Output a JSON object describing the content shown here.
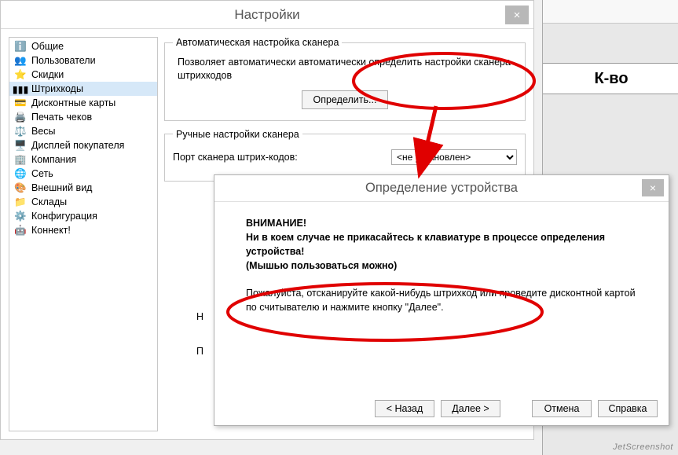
{
  "mainWindow": {
    "title": "Настройки",
    "close": "×"
  },
  "sidebar": {
    "items": [
      {
        "icon": "ℹ️",
        "label": "Общие"
      },
      {
        "icon": "👥",
        "label": "Пользователи"
      },
      {
        "icon": "⭐",
        "label": "Скидки"
      },
      {
        "icon": "▮▮▮",
        "label": "Штрихкоды",
        "selected": true
      },
      {
        "icon": "💳",
        "label": "Дисконтные карты"
      },
      {
        "icon": "🖨️",
        "label": "Печать чеков"
      },
      {
        "icon": "⚖️",
        "label": "Весы"
      },
      {
        "icon": "🖥️",
        "label": "Дисплей покупателя"
      },
      {
        "icon": "🏢",
        "label": "Компания"
      },
      {
        "icon": "🌐",
        "label": "Сеть"
      },
      {
        "icon": "🎨",
        "label": "Внешний вид"
      },
      {
        "icon": "📁",
        "label": "Склады"
      },
      {
        "icon": "⚙️",
        "label": "Конфигурация"
      },
      {
        "icon": "🤖",
        "label": "Коннект!"
      }
    ]
  },
  "autoGroup": {
    "legend": "Автоматическая настройка сканера",
    "desc": "Позволяет автоматически автоматически определить настройки сканера штрихкодов",
    "btn": "Определить..."
  },
  "manualGroup": {
    "legend": "Ручные настройки сканера",
    "portLabel": "Порт сканера штрих-кодов:",
    "portValue": "<не установлен>"
  },
  "hidden": {
    "h1": "Н",
    "h2": "П"
  },
  "modal": {
    "title": "Определение устройства",
    "close": "×",
    "warnTitle": "ВНИМАНИЕ!",
    "warnLine1": "Ни в коем случае не прикасайтесь к клавиатуре в процессе определения устройства!",
    "warnLine2": "(Мышью пользоваться можно)",
    "mainText": "Пожалуйста, отсканируйте какой-нибудь штрихкод или проведите дисконтной картой по считывателю и нажмите кнопку \"Далее\".",
    "btnBack": "< Назад",
    "btnNext": "Далее >",
    "btnCancel": "Отмена",
    "btnHelp": "Справка"
  },
  "bg": {
    "header": "К-во"
  },
  "watermark": "JetScreenshot"
}
